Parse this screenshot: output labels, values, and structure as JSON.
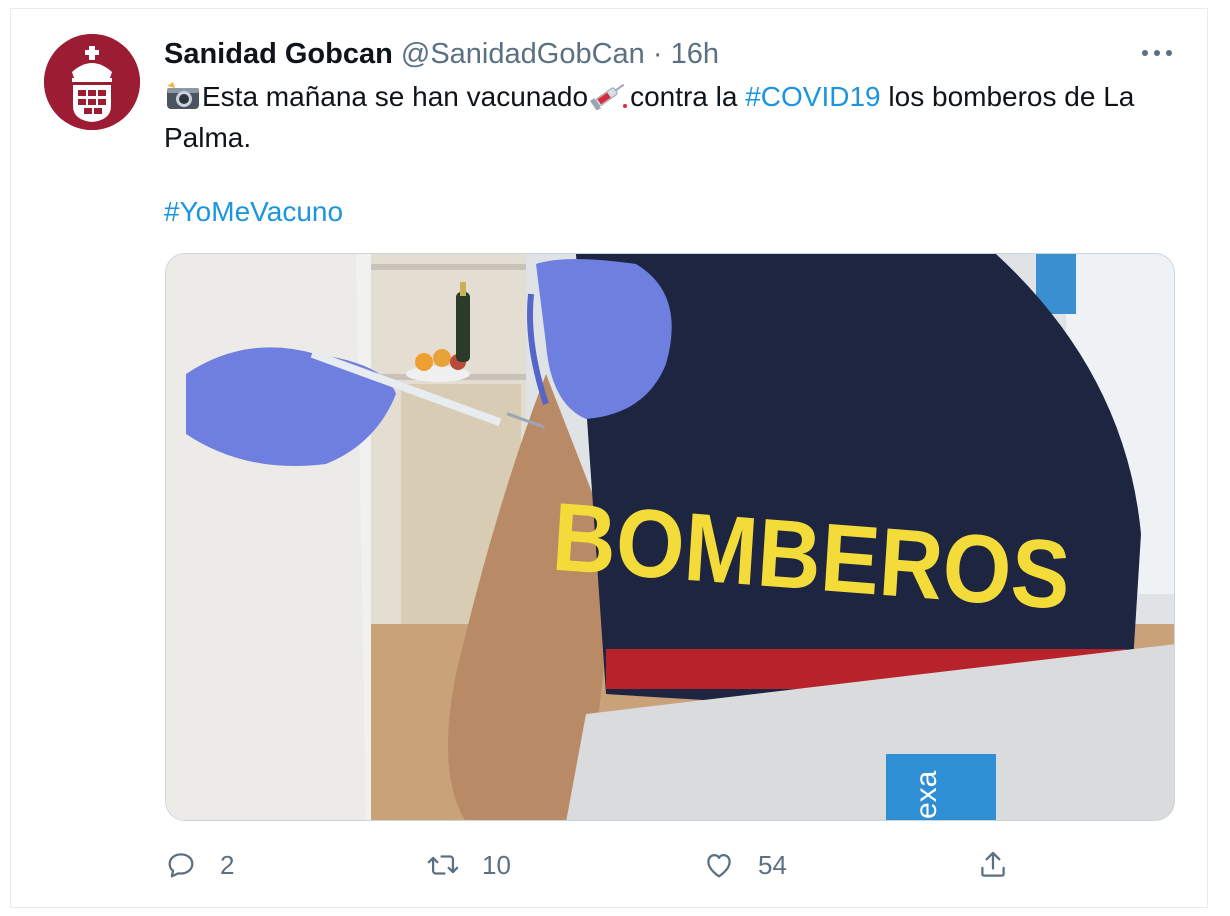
{
  "tweet": {
    "author_name": "Sanidad Gobcan",
    "handle": "@SanidadGobCan",
    "separator": "·",
    "time": "16h",
    "text_part1": "Esta mañana se han vacunado",
    "text_part2": "contra la ",
    "hashtag1": "#COVID19",
    "text_part3": " los bomberos de La Palma.",
    "hashtag2": "#YoMeVacuno",
    "emoji_camera": "camera-flash-icon",
    "emoji_syringe": "syringe-icon",
    "image": {
      "shirt_text": "BOMBEROS",
      "chair_text": "er\nexa",
      "colors": {
        "shirt": "#1d2540",
        "glove": "#6e7fe0",
        "shirt_text": "#f3dc3a",
        "wall": "#e9eef2"
      }
    }
  },
  "actions": {
    "reply_count": "2",
    "retweet_count": "10",
    "like_count": "54"
  },
  "colors": {
    "accent": "#1b95e0",
    "muted": "#5b7083",
    "avatar_bg": "#9c1c34"
  }
}
